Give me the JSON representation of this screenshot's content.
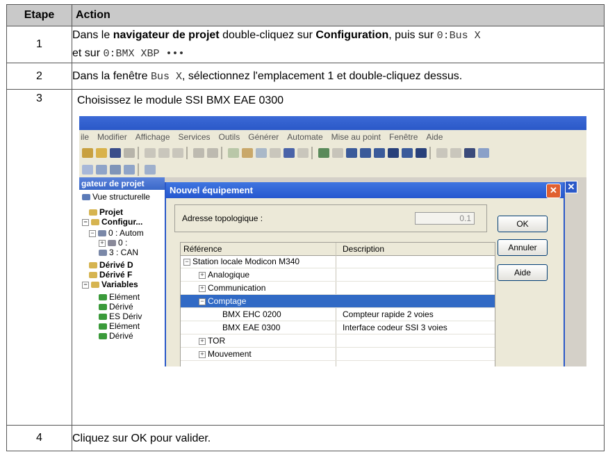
{
  "table": {
    "headers": {
      "step": "Etape",
      "action": "Action"
    },
    "rows": [
      {
        "step": "1",
        "t1": "Dans le ",
        "b1": "navigateur de projet",
        "t2": " double-cliquez sur ",
        "b2": "Configuration",
        "t3": ", puis sur ",
        "code1": "0:Bus X",
        "t4": "et sur ",
        "code2": "0:BMX XBP •••"
      },
      {
        "step": "2",
        "t1": "Dans la fenêtre ",
        "code1": "Bus X",
        "t2": ", sélectionnez l'emplacement 1 et double-cliquez dessus."
      },
      {
        "step": "3",
        "text": "Choisissez le module SSI BMX EAE 0300"
      },
      {
        "step": "4",
        "text": "Cliquez sur OK pour valider."
      }
    ]
  },
  "screenshot": {
    "menu": [
      "ile",
      "Modifier",
      "Affichage",
      "Services",
      "Outils",
      "Générer",
      "Automate",
      "Mise au point",
      "Fenêtre",
      "Aide"
    ],
    "browser_title": "gateur de projet",
    "tree": {
      "structural_view": "Vue structurelle",
      "project": "Projet",
      "config": "Configur...",
      "auto": "0 : Autom",
      "rack": "0 :",
      "can": "3 : CAN",
      "derived_d": "Dérivé D",
      "derived_f": "Dérivé F",
      "variables": "Variables",
      "v1": "Elément",
      "v2": "Dérivé",
      "v3": "ES Dériv",
      "v4": "Elément",
      "v5": "Dérivé"
    },
    "dialog": {
      "title": "Nouvel équipement",
      "close": "✕",
      "address_label": "Adresse topologique :",
      "address_value": "0.1",
      "ok": "OK",
      "cancel": "Annuler",
      "help": "Aide",
      "col_reference": "Référence",
      "col_description": "Description",
      "rows": [
        {
          "ref": "Station locale Modicon M340",
          "desc": ""
        },
        {
          "ref": "Analogique",
          "desc": ""
        },
        {
          "ref": "Communication",
          "desc": ""
        },
        {
          "ref": "Comptage",
          "desc": ""
        },
        {
          "ref": "BMX EHC 0200",
          "desc": "Compteur rapide 2 voies"
        },
        {
          "ref": "BMX EAE 0300",
          "desc": "Interface codeur SSI 3 voies"
        },
        {
          "ref": "TOR",
          "desc": ""
        },
        {
          "ref": "Mouvement",
          "desc": ""
        }
      ]
    },
    "bg_close": "✕"
  }
}
